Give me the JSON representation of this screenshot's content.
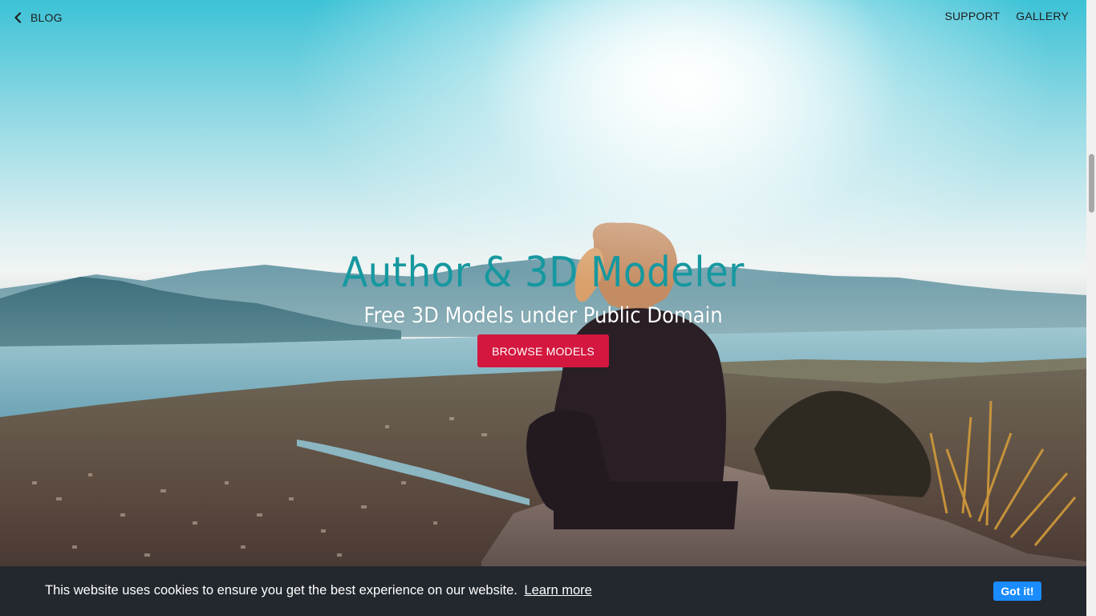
{
  "nav": {
    "back_label": "BLOG",
    "back_icon": "chevron-left-icon",
    "links": [
      {
        "label": "SUPPORT"
      },
      {
        "label": "GALLERY"
      }
    ]
  },
  "hero": {
    "title": "Author & 3D Modeler",
    "subtitle": "Free 3D Models under Public Domain",
    "cta_label": "BROWSE MODELS",
    "background_image": "woman-sitting-on-rock-overlooking-coastal-town-and-bay",
    "title_color": "#16989f",
    "cta_color": "#d3173f"
  },
  "cookie_banner": {
    "message": "This website uses cookies to ensure you get the best experience on our website.",
    "learn_more_label": "Learn more",
    "accept_label": "Got it!",
    "background_color": "#23272e",
    "accept_color": "#1a8cff"
  }
}
